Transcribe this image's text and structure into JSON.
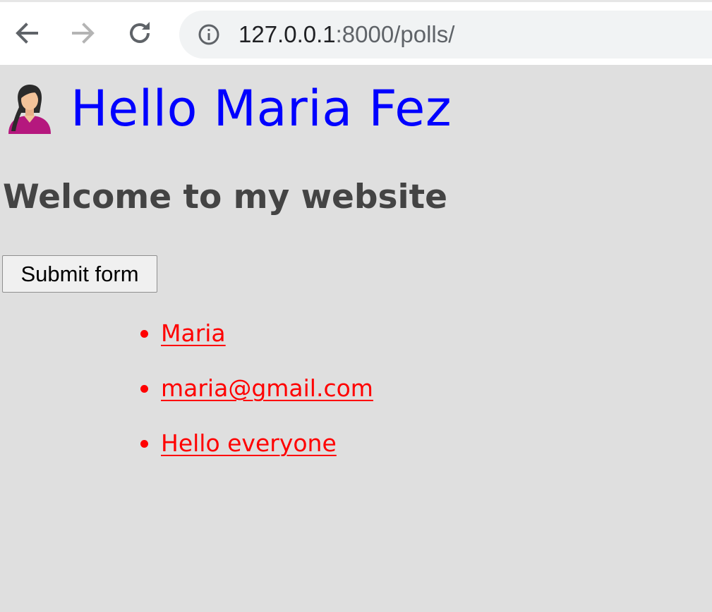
{
  "browser": {
    "url_host": "127.0.0.1",
    "url_rest": ":8000/polls/",
    "icons": {
      "back": "arrow-left-icon",
      "forward": "arrow-right-icon",
      "reload": "reload-icon",
      "site_info": "info-icon"
    }
  },
  "page": {
    "greeting": "Hello Maria Fez",
    "welcome": "Welcome to my website",
    "submit_label": "Submit form",
    "links": [
      {
        "label": "Maria"
      },
      {
        "label": "maria@gmail.com"
      },
      {
        "label": "Hello everyone"
      }
    ]
  },
  "colors": {
    "background": "#dfdfdf",
    "greeting": "#0000ff",
    "welcome": "#444444",
    "links": "#ff0000"
  }
}
